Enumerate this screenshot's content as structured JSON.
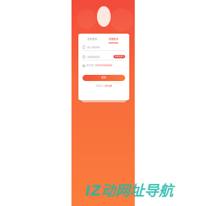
{
  "tabs": {
    "password_login": "密码登录",
    "quick_login": "快捷登录"
  },
  "phone_field": {
    "placeholder": "输入手机号码"
  },
  "code_field": {
    "placeholder": "请填写验证码",
    "get_code_button": "获取验证码"
  },
  "agreement": {
    "prefix": "我已同意",
    "link": "《用户协议及隐私政策》"
  },
  "login_button": "登录",
  "register": {
    "prefix": "没有账号?",
    "link": "立即注册"
  },
  "watermark": {
    "text": "IZ动网址导航"
  },
  "colors": {
    "accent": "#f0463c",
    "gradient_top": "#f24a3b",
    "gradient_bottom": "#fb7d3c",
    "watermark": "#1fb8a8"
  }
}
